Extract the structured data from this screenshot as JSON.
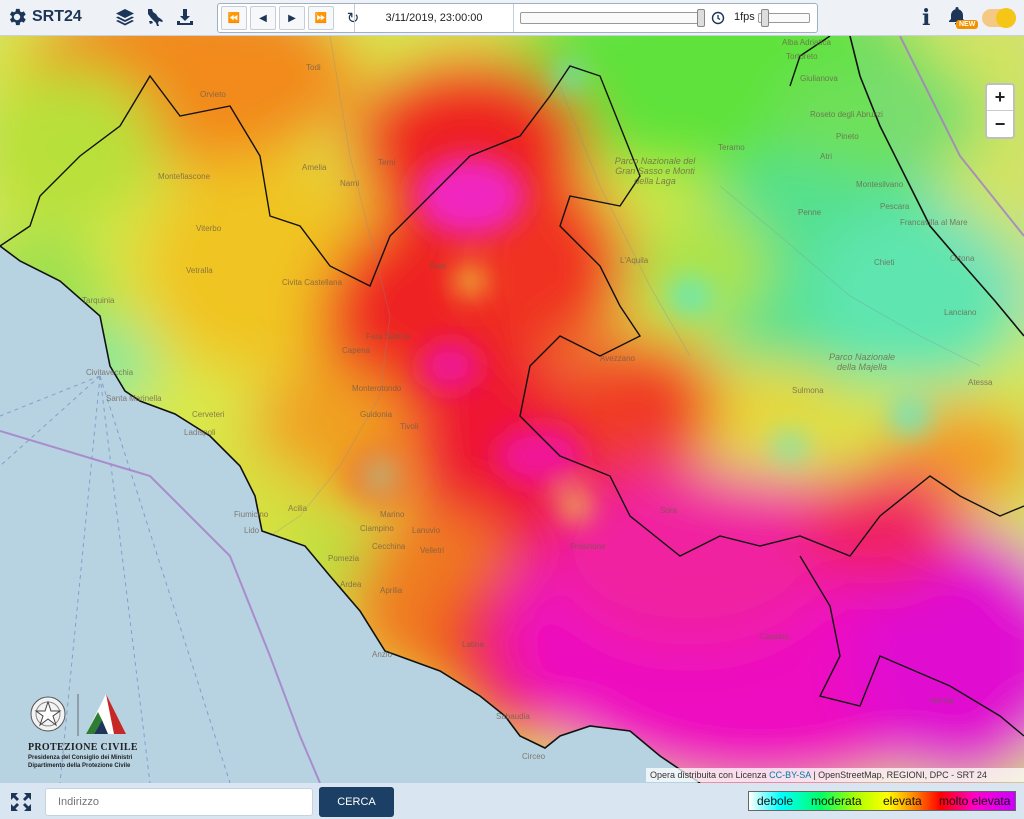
{
  "app": {
    "title": "SRT24"
  },
  "toolbar": {
    "icons": [
      "layers-icon",
      "italy-map-icon",
      "download-icon"
    ]
  },
  "player": {
    "datetime": "3/11/2019, 23:00:00",
    "fps_label": "1fps",
    "time_slider_fraction": 1.0
  },
  "header_right": {
    "info_label": "i",
    "new_badge": "NEW"
  },
  "map": {
    "zoom_in": "+",
    "zoom_out": "−",
    "places": [
      "Todi",
      "Orvieto",
      "Amelia",
      "Narni",
      "Terni",
      "Montefiascone",
      "Viterbo",
      "Vetralla",
      "Civita Castellana",
      "Tarquinia",
      "Civitavecchia",
      "Santa Marinella",
      "Cerveteri",
      "Ladispoli",
      "Fiumicino",
      "Lido",
      "Acilia",
      "Pomezia",
      "Ardea",
      "Aprilia",
      "Anzio",
      "Latina",
      "Sabaudia",
      "Circeo",
      "Ciampino",
      "Marino",
      "Velletri",
      "Cecchina",
      "Lanuvio",
      "Monterotondo",
      "Guidonia",
      "Tivoli",
      "Capena",
      "Fara Sabina",
      "Rieti",
      "L'Aquila",
      "Avezzano",
      "Sulmona",
      "Teramo",
      "Atri",
      "Penne",
      "Pescara",
      "Chieti",
      "Lanciano",
      "Ortona",
      "Atessa",
      "Francavilla al Mare",
      "Montesilvano",
      "Giulianova",
      "Tortoreto",
      "Alba Adriatica",
      "Roseto degli Abruzzi",
      "Pineto",
      "Cassino",
      "Frosinone",
      "Sora",
      "Isernia",
      "Parco Nazionale della Majella",
      "Parco Nazionale del Gran Sasso e Monti della Laga"
    ]
  },
  "logo": {
    "name": "PROTEZIONE CIVILE",
    "line1": "Presidenza del Consiglio dei Ministri",
    "line2": "Dipartimento della Protezione Civile"
  },
  "attribution": {
    "prefix": "Opera distribuita con Licenza ",
    "license": "CC-BY-SA",
    "suffix": " | OpenStreetMap, REGIONI, DPC - SRT 24"
  },
  "search": {
    "placeholder": "Indirizzo",
    "button": "CERCA"
  },
  "legend": {
    "labels": [
      "debole",
      "moderata",
      "elevata",
      "molto elevata"
    ],
    "colors": [
      "#ffffff",
      "#00ffff",
      "#00ff66",
      "#ffff00",
      "#ff0000",
      "#ff00cc",
      "#cc00ff"
    ]
  }
}
